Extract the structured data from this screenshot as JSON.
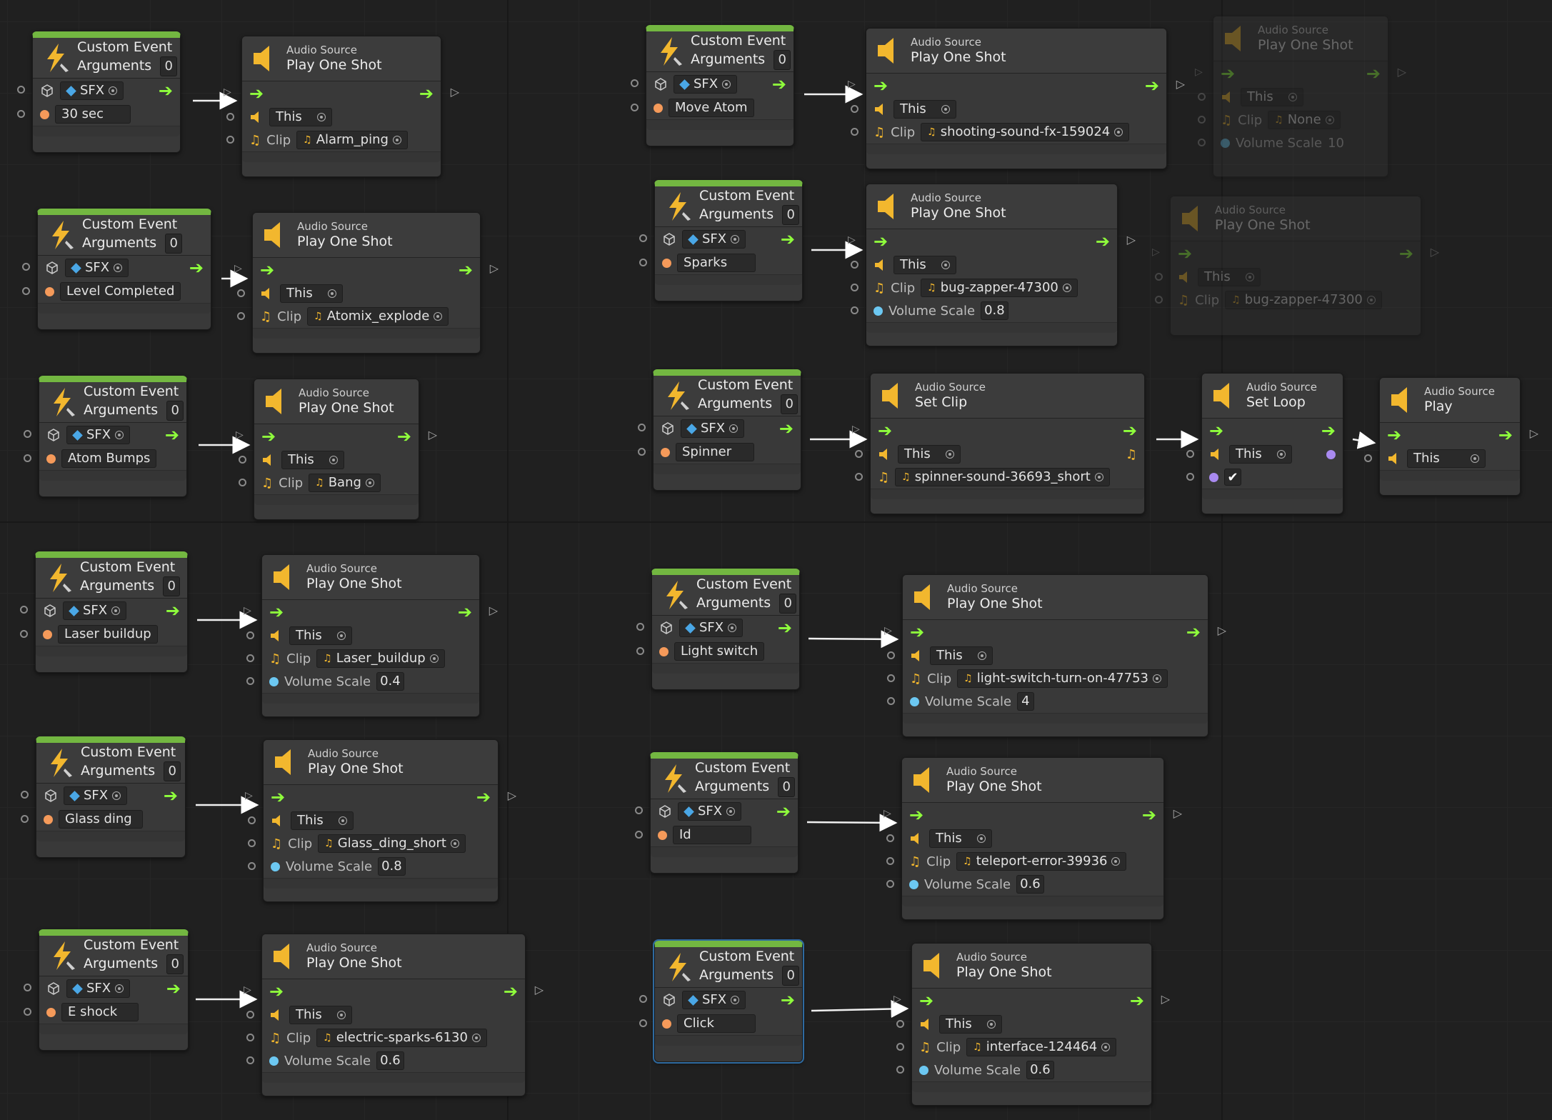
{
  "labels": {
    "custom_event": "Custom Event",
    "arguments": "Arguments",
    "audio_source": "Audio Source",
    "sfx": "SFX",
    "this": "This",
    "clip": "Clip",
    "volume_scale": "Volume Scale"
  },
  "nodes": {
    "e1": {
      "arg": "0",
      "value": "30 sec"
    },
    "a1": {
      "method": "Play One Shot",
      "clip": "Alarm_ping"
    },
    "e2": {
      "arg": "0",
      "value": "Level Completed"
    },
    "a2": {
      "method": "Play One Shot",
      "clip": "Atomix_explode"
    },
    "e3": {
      "arg": "0",
      "value": "Atom Bumps"
    },
    "a3": {
      "method": "Play One Shot",
      "clip": "Bang"
    },
    "e4": {
      "arg": "0",
      "value": "Laser buildup"
    },
    "a4": {
      "method": "Play One Shot",
      "clip": "Laser_buildup",
      "volume": "0.4"
    },
    "e5": {
      "arg": "0",
      "value": "Glass ding"
    },
    "a5": {
      "method": "Play One Shot",
      "clip": "Glass_ding_short",
      "volume": "0.8"
    },
    "e6": {
      "arg": "0",
      "value": "E shock"
    },
    "a6": {
      "method": "Play One Shot",
      "clip": "electric-sparks-6130",
      "volume": "0.6"
    },
    "e7": {
      "arg": "0",
      "value": "Move Atom"
    },
    "a7": {
      "method": "Play One Shot",
      "clip": "shooting-sound-fx-159024"
    },
    "f1": {
      "method": "Play One Shot",
      "clip": "None",
      "volume": "10"
    },
    "e8": {
      "arg": "0",
      "value": "Sparks"
    },
    "a8": {
      "method": "Play One Shot",
      "clip": "bug-zapper-47300",
      "volume": "0.8"
    },
    "f2": {
      "method": "Play One Shot",
      "clip": "bug-zapper-47300"
    },
    "e9": {
      "arg": "0",
      "value": "Spinner"
    },
    "s1": {
      "method": "Set Clip",
      "clip": "spinner-sound-36693_short"
    },
    "s2": {
      "method": "Set Loop"
    },
    "s3": {
      "method": "Play"
    },
    "e10": {
      "arg": "0",
      "value": "Light switch"
    },
    "a10": {
      "method": "Play One Shot",
      "clip": "light-switch-turn-on-47753",
      "volume": "4"
    },
    "e11": {
      "arg": "0",
      "value": "Id"
    },
    "a11": {
      "method": "Play One Shot",
      "clip": "teleport-error-39936",
      "volume": "0.6"
    },
    "e12": {
      "arg": "0",
      "value": "Click"
    },
    "a12": {
      "method": "Play One Shot",
      "clip": "interface-124464",
      "volume": "0.6"
    }
  },
  "colors": {
    "flow_arrow": "#8fff3c",
    "event_bar": "#73b741",
    "speaker_icon": "#f2b72e",
    "string_port": "#f59a5a",
    "float_port": "#6cc8f2",
    "bool_port": "#a98af0"
  }
}
